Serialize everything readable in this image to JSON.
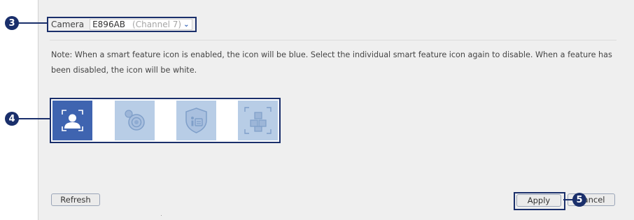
{
  "camera": {
    "label": "Camera",
    "name": "E896AB",
    "channel": "(Channel 7)"
  },
  "note": "Note: When a smart feature icon is enabled, the icon will be blue. Select the individual smart feature icon again to disable. When a feature has been disabled, the icon will be white.",
  "smart_features": [
    {
      "icon": "face-detection-icon",
      "state": "enabled"
    },
    {
      "icon": "camera-lens-icon",
      "state": "enabled"
    },
    {
      "icon": "shield-id-icon",
      "state": "enabled"
    },
    {
      "icon": "object-detection-icon",
      "state": "enabled"
    }
  ],
  "buttons": {
    "refresh": "Refresh",
    "apply": "Apply",
    "cancel": "Cancel"
  },
  "callouts": [
    "3",
    "4",
    "5"
  ],
  "colors": {
    "panel_bg": "#efefef",
    "callout": "#1a2f6b",
    "tile_active": "#3f64b0",
    "tile_inactive": "#b8cde6",
    "accent": "#2c5fb3"
  }
}
